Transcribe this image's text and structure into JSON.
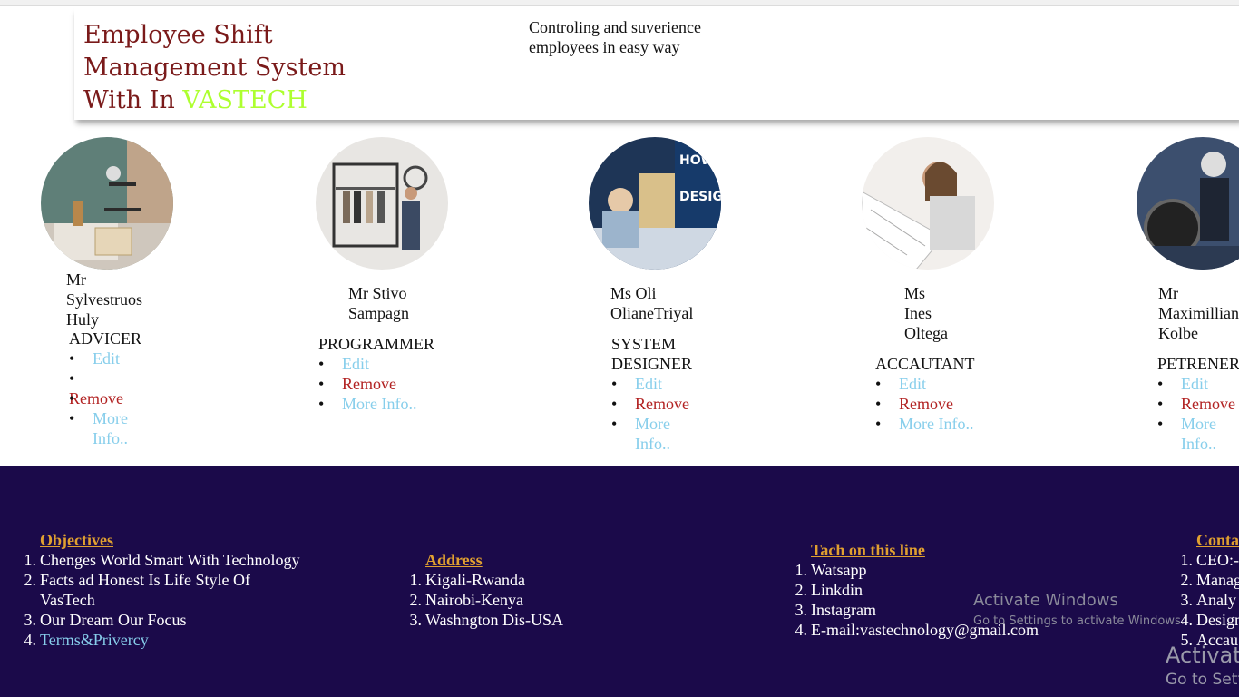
{
  "header": {
    "title_line1": "Employee Shift",
    "title_line2": "Management System",
    "title_line3_prefix": "With In ",
    "title_brand": "VASTECH",
    "tagline": "Controling and suverience employees in easy way",
    "colors": {
      "title": "#7a1a1a",
      "brand": "#adff2f"
    }
  },
  "employees": [
    {
      "name_line1": "Mr",
      "name_line2": "Sylvestruos",
      "name_line3": "Huly",
      "role": "ADVICER",
      "edit": "Edit",
      "remove": "Remove",
      "more": "More Info..",
      "photo": "interior-shelf-photo"
    },
    {
      "name_line1": "Mr Stivo",
      "name_line2": "Sampagn",
      "name_line3": "",
      "role": "PROGRAMMER",
      "edit": "Edit",
      "remove": "Remove",
      "more": "More Info..",
      "photo": "wardrobe-photo"
    },
    {
      "name_line1": "Ms Oli",
      "name_line2": "OlianeTriyal",
      "name_line3": "",
      "role": "SYSTEM DESIGNER",
      "edit": "Edit",
      "remove": "Remove",
      "more": "More Info..",
      "photo": "design-engineer-photo"
    },
    {
      "name_line1": "Ms",
      "name_line2": "Ines",
      "name_line3": "Oltega",
      "role": "ACCAUTANT",
      "edit": "Edit",
      "remove": "Remove",
      "more": "More Info..",
      "photo": "blueprint-woman-photo"
    },
    {
      "name_line1": "Mr",
      "name_line2": "Maximillian",
      "name_line3": "Kolbe",
      "role": "PETRENER",
      "edit": "Edit",
      "remove": "Remove",
      "more": "More Info..",
      "photo": "worker-machine-photo"
    }
  ],
  "footer": {
    "objectives": {
      "heading": "Objectives",
      "items": [
        "Chenges World Smart With Technology",
        "Facts ad Honest Is Life Style Of",
        "VasTech",
        "Our Dream Our Focus",
        "Terms&Privercy"
      ]
    },
    "address": {
      "heading": "Address",
      "items": [
        "Kigali-Rwanda",
        "Nairobi-Kenya",
        "Washngton Dis-USA"
      ]
    },
    "touch": {
      "heading": "Tach on this line",
      "items": [
        "Watsapp",
        "Linkdin",
        "Instagram",
        "E-mail:vastechnology@gmail.com"
      ]
    },
    "contact": {
      "heading": "Conta",
      "items": [
        "CEO:-",
        "Manag",
        "Analy",
        "Design",
        "Accau"
      ]
    },
    "colors": {
      "background": "#1b0a4a",
      "heading": "#e0a030",
      "link": "#87ceeb"
    }
  },
  "watermark": {
    "line1": "Activate Windows",
    "line2": "Go to Settings to activate Windows.",
    "line3": "Activate",
    "line4": "Go to Setti"
  }
}
